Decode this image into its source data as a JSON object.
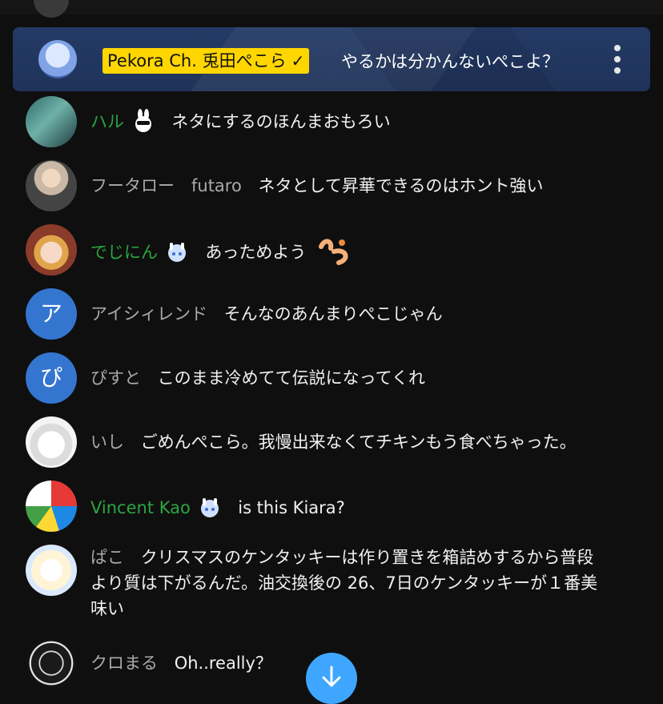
{
  "pinned": {
    "author": "Pekora Ch. 兎田ぺこら",
    "verified_icon": "checkmark-icon",
    "message": "やるかは分かんないぺこよ？",
    "menu_icon": "more-vert-icon",
    "colors": {
      "background": "#243a66",
      "author_highlight": "#ffd600"
    }
  },
  "messages": [
    {
      "author": "ハル",
      "is_member": true,
      "badge": "member-badge-icon",
      "text": "ネタにするのほんまおもろい"
    },
    {
      "author": "フータロー　futaro",
      "is_member": false,
      "text": "ネタとして昇華できるのはホント強い"
    },
    {
      "author": "でじにん",
      "is_member": true,
      "badge": "member-badge-icon",
      "text": "あっためよう",
      "emoji": "pekora-emoji-icon"
    },
    {
      "author": "アイシィレンド",
      "is_member": false,
      "avatar_letter": "ア",
      "text": "そんなのあんまりぺこじゃん"
    },
    {
      "author": "ぴすと",
      "is_member": false,
      "avatar_letter": "ぴ",
      "text": "このまま冷めてて伝説になってくれ"
    },
    {
      "author": "いし",
      "is_member": false,
      "text": "ごめんぺこら。我慢出来なくてチキンもう食べちゃった。"
    },
    {
      "author": "Vincent Kao",
      "is_member": true,
      "badge": "member-badge-icon",
      "text": "is this Kiara?"
    },
    {
      "author": "ぱこ",
      "is_member": false,
      "text_line1": "クリスマスのケンタッキーは作り置きを箱詰めするから普段",
      "text_line2": "より質は下がるんだ。油交換後の 26、7日のケンタッキーが１番美",
      "text_line3": "味い"
    },
    {
      "author": "クロまる",
      "is_member": false,
      "text": "Oh..really？"
    }
  ],
  "scroll_button": {
    "icon": "arrow-down-icon",
    "color": "#3ea6ff"
  },
  "colors": {
    "background": "#0f0f0f",
    "member_name": "#2ba640",
    "name": "#aaaaaa",
    "text": "#f1f1f1"
  }
}
